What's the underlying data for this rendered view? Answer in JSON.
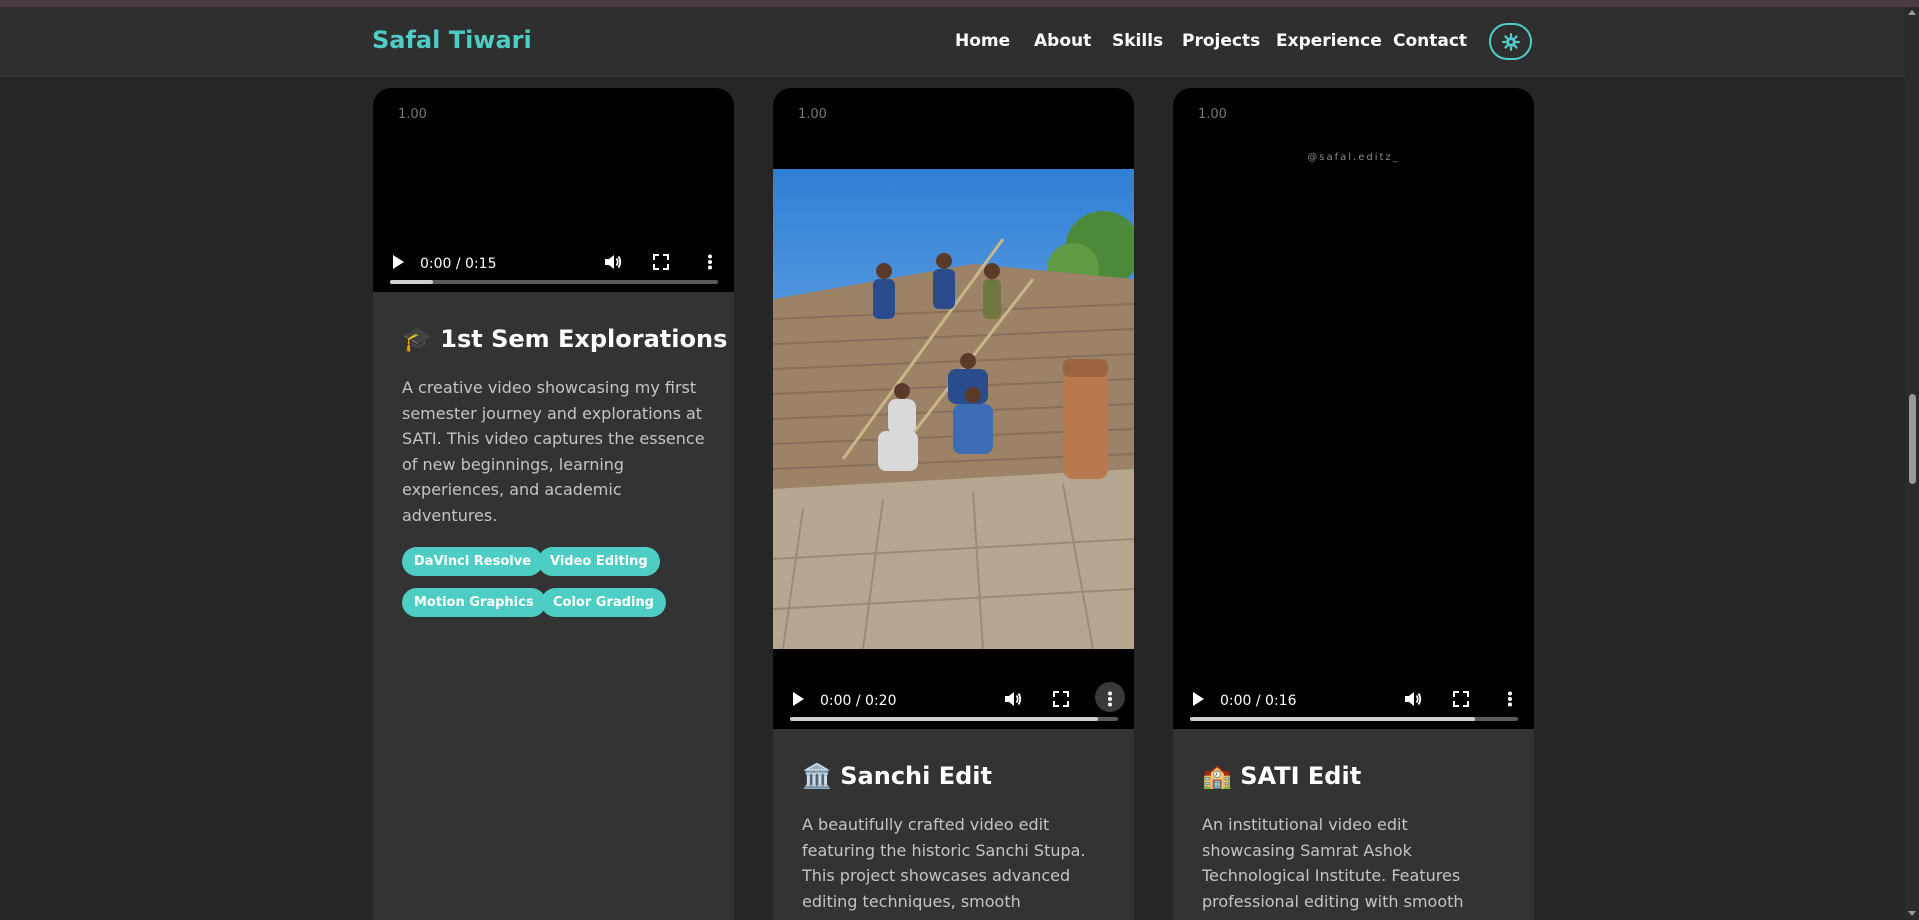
{
  "brand": "Safal Tiwari",
  "nav": [
    "Home",
    "About",
    "Skills",
    "Projects",
    "Experience",
    "Contact"
  ],
  "theme_toggle_icon": "gear-icon",
  "accent": "#4ecdc4",
  "cards": [
    {
      "speed": "1.00",
      "time": "0:00 / 0:15",
      "progress": 0.13,
      "icon": "🎓",
      "title": "1st Sem Explorations",
      "description": "A creative video showcasing my first semester journey and explorations at SATI. This video captures the essence of new beginnings, learning experiences, and academic adventures.",
      "tags": [
        "DaVinci Resolve",
        "Video Editing",
        "Motion Graphics",
        "Color Grading"
      ]
    },
    {
      "speed": "1.00",
      "time": "0:00 / 0:20",
      "progress": 0.94,
      "icon": "🏛️",
      "title": "Sanchi Edit",
      "description": "A beautifully crafted video edit featuring the historic Sanchi Stupa. This project showcases advanced editing techniques, smooth"
    },
    {
      "speed": "1.00",
      "watermark": "@safal.editz_",
      "time": "0:00 / 0:16",
      "progress": 0.87,
      "icon": "🏫",
      "title": "SATI Edit",
      "description": "An institutional video edit showcasing Samrat Ashok Technological Institute. Features professional editing with smooth"
    }
  ]
}
